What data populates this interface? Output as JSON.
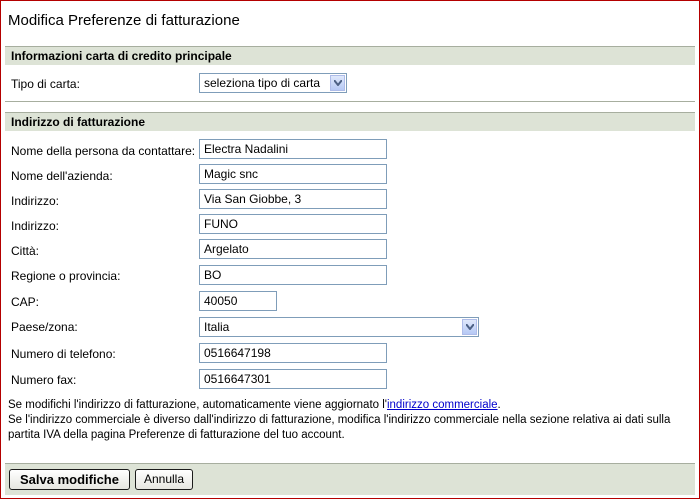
{
  "page": {
    "title": "Modifica Preferenze di fatturazione"
  },
  "card_section": {
    "header": "Informazioni carta di credito principale",
    "card_type_label": "Tipo di carta:",
    "card_type_value": "seleziona tipo di carta"
  },
  "billing_section": {
    "header": "Indirizzo di fatturazione",
    "fields": {
      "contact_name": {
        "label": "Nome della persona da contattare:",
        "value": "Electra Nadalini"
      },
      "company": {
        "label": "Nome dell'azienda:",
        "value": "Magic snc"
      },
      "address1": {
        "label": "Indirizzo:",
        "value": "Via San Giobbe, 3"
      },
      "address2": {
        "label": "Indirizzo:",
        "value": "FUNO"
      },
      "city": {
        "label": "Città:",
        "value": "Argelato"
      },
      "region": {
        "label": "Regione o provincia:",
        "value": "BO"
      },
      "postal_code": {
        "label": "CAP:",
        "value": "40050"
      },
      "country": {
        "label": "Paese/zona:",
        "value": "Italia"
      },
      "phone": {
        "label": "Numero di telefono:",
        "value": "0516647198"
      },
      "fax": {
        "label": "Numero fax:",
        "value": "0516647301"
      }
    }
  },
  "notes": {
    "line1_prefix": "Se modifichi l'indirizzo di fatturazione, automaticamente viene aggiornato l'",
    "line1_link": "indirizzo commerciale",
    "line1_suffix": ".",
    "line2": "Se l'indirizzo commerciale è diverso dall'indirizzo di fatturazione, modifica l'indirizzo commerciale nella sezione relativa ai dati sulla partita IVA della pagina Preferenze di fatturazione del tuo account."
  },
  "footer": {
    "save_label": "Salva modifiche",
    "cancel_label": "Annulla"
  },
  "colors": {
    "frame_border": "#b40000",
    "section_bg": "#dde3d6",
    "link": "#0000cc"
  },
  "icons": {
    "dropdown": "chevron-down-icon"
  }
}
